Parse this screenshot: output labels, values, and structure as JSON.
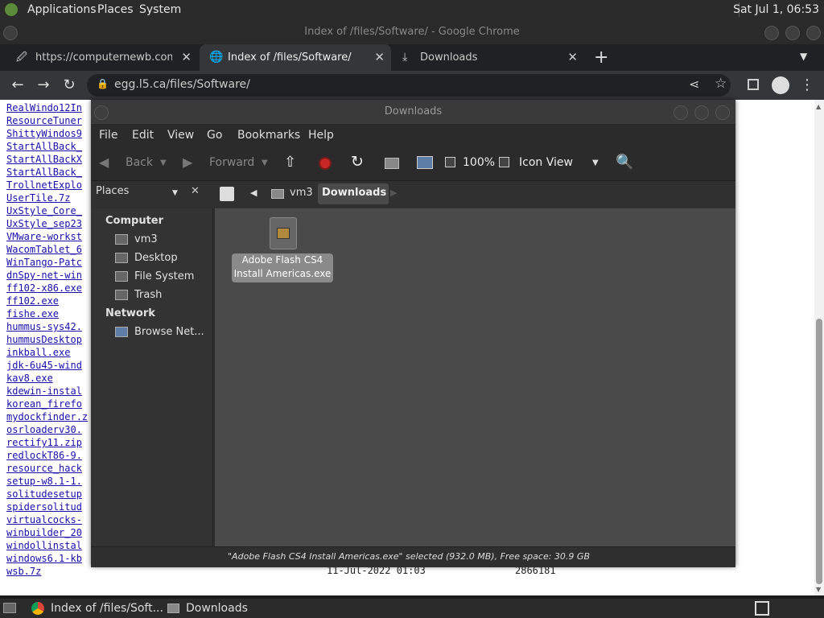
{
  "top_panel": {
    "menus": [
      "Applications",
      "Places",
      "System"
    ],
    "clock": "Sat Jul 1, 06:53"
  },
  "chrome": {
    "window_title": "Index of /files/Software/ - Google Chrome",
    "tabs": [
      {
        "label": "https://computernewb.com/CH",
        "active": false
      },
      {
        "label": "Index of /files/Software/",
        "active": true
      },
      {
        "label": "Downloads",
        "active": false
      }
    ],
    "url": "egg.l5.ca/files/Software/"
  },
  "page": {
    "files": [
      "RealWindo12In",
      "ResourceTuner",
      "ShittyWindos9",
      "StartAllBack_",
      "StartAllBackX",
      "StartAllBack_",
      "TrollnetExplo",
      "UserTile.7z",
      "UxStyle_Core_",
      "UxStyle_sep23",
      "VMware-workst",
      "WacomTablet_6",
      "WinTango-Patc",
      "dnSpy-net-win",
      "ff102-x86.exe",
      "ff102.exe",
      "fishe.exe",
      "hummus-sys42.",
      "hummusDesktop",
      "inkball.exe",
      "jdk-6u45-wind",
      "kav8.exe",
      "kdewin-instal",
      "korean_firefo",
      "mydockfinder.z",
      "osrloaderv30.",
      "rectify11.zip",
      "redlockT86-9.",
      "resource_hack",
      "setup-w8.1-1.",
      "solitudesetup",
      "spidersolitud",
      "virtualcocks-",
      "winbuilder_20",
      "windollinstal",
      "windows6.1-kb",
      "wsb.7z"
    ],
    "last_date": "11-Jul-2022 01:03",
    "last_size": "2866181"
  },
  "file_manager": {
    "title": "Downloads",
    "menus": [
      "File",
      "Edit",
      "View",
      "Go",
      "Bookmarks",
      "Help"
    ],
    "toolbar": {
      "back": "Back",
      "forward": "Forward",
      "zoom": "100%",
      "view_mode": "Icon View"
    },
    "sidebar_label": "Places",
    "path": [
      "vm3",
      "Downloads"
    ],
    "sidebar": {
      "computer_header": "Computer",
      "computer_items": [
        "vm3",
        "Desktop",
        "File System",
        "Trash"
      ],
      "network_header": "Network",
      "network_items": [
        "Browse Net..."
      ]
    },
    "file": {
      "line1": "Adobe Flash CS4",
      "line2": "Install Americas.exe"
    },
    "status": "\"Adobe Flash CS4 Install Americas.exe\" selected (932.0 MB), Free space: 30.9 GB"
  },
  "taskbar": {
    "items": [
      "Index of /files/Soft...",
      "Downloads"
    ]
  }
}
